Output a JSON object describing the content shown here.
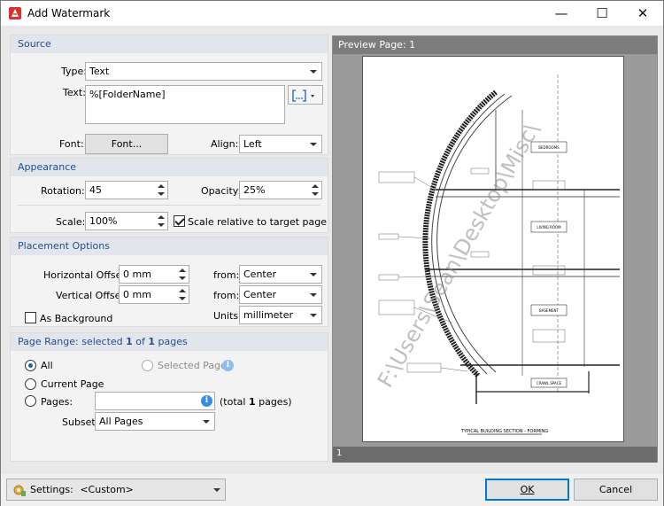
{
  "window": {
    "title": "Add Watermark",
    "minimize_glyph": "—",
    "maximize_glyph": "☐",
    "close_glyph": "✕"
  },
  "source": {
    "header": "Source",
    "type_label": "Type:",
    "type_value": "Text",
    "text_label": "Text:",
    "text_value": "%[FolderName]",
    "font_label": "Font:",
    "font_button": "Font...",
    "align_label": "Align:",
    "align_value": "Left"
  },
  "appearance": {
    "header": "Appearance",
    "rotation_label": "Rotation:",
    "rotation_value": "45",
    "opacity_label": "Opacity:",
    "opacity_value": "25%",
    "scale_label": "Scale:",
    "scale_value": "100%",
    "scale_relative_label": "Scale relative to target page",
    "scale_relative_checked": true
  },
  "placement": {
    "header": "Placement Options",
    "h_offset_label": "Horizontal Offset:",
    "h_offset_value": "0 mm",
    "v_offset_label": "Vertical Offset:",
    "v_offset_value": "0 mm",
    "from_label_1": "from:",
    "from_value_1": "Center",
    "from_label_2": "from:",
    "from_value_2": "Center",
    "units_label": "Units:",
    "units_value": "millimeter",
    "background_label": "As Background",
    "background_checked": false
  },
  "page_range": {
    "header_prefix": "Page Range: selected ",
    "selected_count": "1",
    "header_middle": " of ",
    "total_count": "1",
    "header_suffix": " pages",
    "all_label": "All",
    "selected_pages_label": "Selected Pages",
    "current_page_label": "Current Page",
    "pages_label": "Pages:",
    "pages_value": "",
    "total_prefix": "(total ",
    "total_pages": "1",
    "total_suffix": " pages)",
    "subset_label": "Subset:",
    "subset_value": "All Pages"
  },
  "preview": {
    "header": "Preview Page: 1",
    "page_number": "1",
    "watermark_text": "F:\\Users\\Sean\\Desktop\\Misc\\",
    "drawing_title": "TYPICAL BUILDING SECTION - FORMING",
    "room_labels": [
      "BEDROOMS",
      "LIVING ROOM",
      "BASEMENT",
      "CRAWL SPACE"
    ]
  },
  "footer": {
    "settings_label": "Settings:",
    "settings_value": "<Custom>",
    "ok_label": "OK",
    "cancel_label": "Cancel"
  },
  "colors": {
    "section_header_text": "#1f4e8c",
    "accent": "#3c8ce7",
    "app_icon": "#d8322e"
  }
}
